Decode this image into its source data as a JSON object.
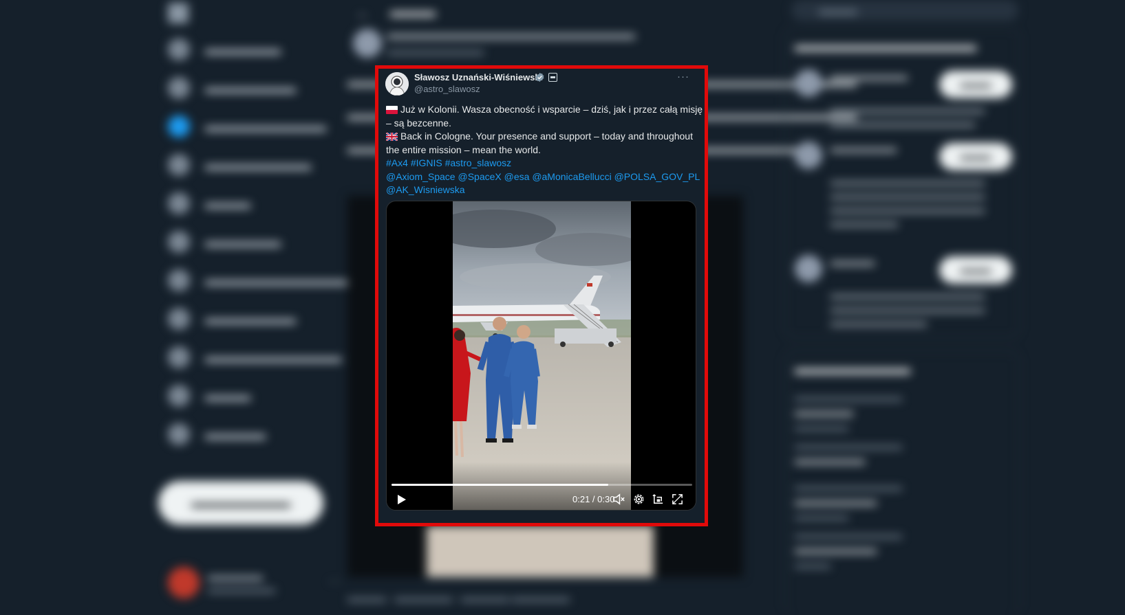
{
  "tweet": {
    "author_name": "Sławosz Uznański-Wiśniewski",
    "author_handle": "@astro_slawosz",
    "more_label": "···",
    "lines": {
      "pl_1": "Już w Kolonii. Wasza obecność i wsparcie – dziś, jak i przez całą misję",
      "pl_2": "– są bezcenne.",
      "en_1": "Back in Cologne. Your presence and support – today and throughout",
      "en_2": "the entire mission – mean the world."
    },
    "hashtags": [
      "#Ax4",
      "#IGNIS",
      "#astro_slawosz"
    ],
    "mentions": [
      "@Axiom_Space",
      "@SpaceX",
      "@esa",
      "@aMonicaBellucci",
      "@POLSA_GOV_PL",
      "@AK_Wisniewska"
    ],
    "video": {
      "time_display": "0:21 / 0:30",
      "progress": 0.72
    },
    "icons": {
      "verified": "verified-badge-icon",
      "affiliation": "affiliation-badge-icon",
      "play": "play-icon",
      "mute": "volume-muted-icon",
      "settings": "settings-gear-icon",
      "pip": "picture-in-picture-icon",
      "fullscreen": "fullscreen-icon"
    }
  },
  "colors": {
    "background": "#15202b",
    "highlight_border": "#e10a0a",
    "link": "#1d9bf0",
    "text": "#e7e9ea",
    "muted": "#8b98a5"
  }
}
